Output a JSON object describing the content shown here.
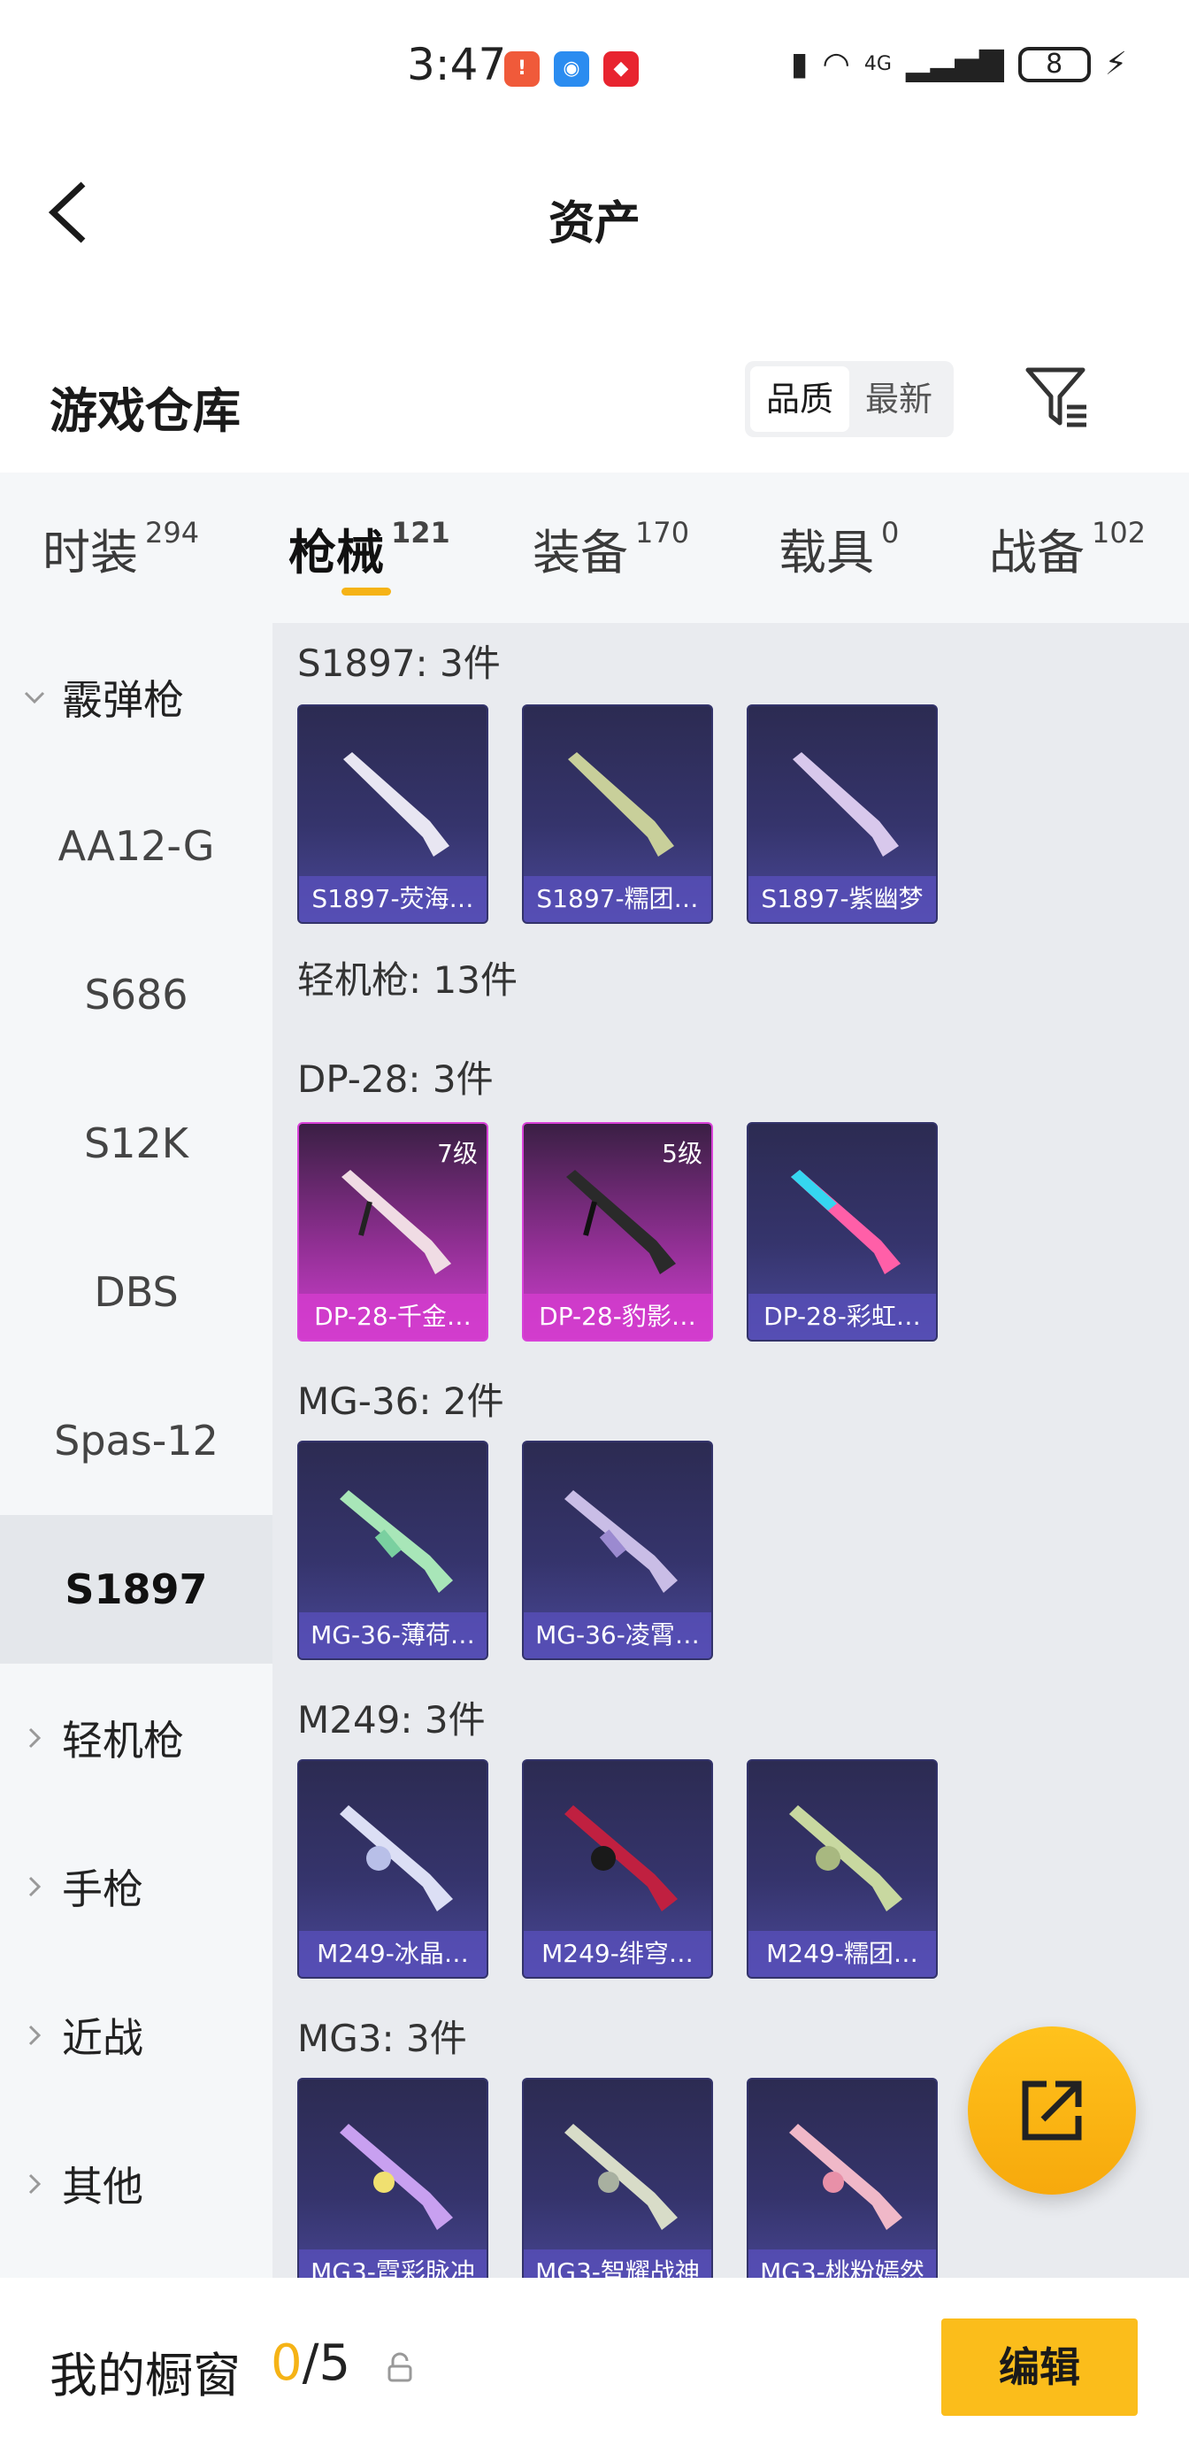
{
  "status_bar": {
    "time": "3:47",
    "battery": "8",
    "network": "4G"
  },
  "header": {
    "title": "资产"
  },
  "warehouse": {
    "title": "游戏仓库",
    "sort_options": [
      "品质",
      "最新"
    ],
    "active_sort": "品质"
  },
  "tabs": [
    {
      "label": "时装",
      "count": "294"
    },
    {
      "label": "枪械",
      "count": "121"
    },
    {
      "label": "装备",
      "count": "170"
    },
    {
      "label": "载具",
      "count": "0"
    },
    {
      "label": "战备",
      "count": "102"
    }
  ],
  "sidebar": {
    "group": "霰弹枪",
    "sub_items": [
      "AA12-G",
      "S686",
      "S12K",
      "DBS",
      "Spas-12",
      "S1897"
    ],
    "selected": "S1897",
    "other_groups": [
      "轻机枪",
      "手枪",
      "近战",
      "其他"
    ]
  },
  "sections": [
    {
      "label": "S1897: 3件",
      "items": [
        {
          "name": "S1897-荧海…",
          "style": "blue"
        },
        {
          "name": "S1897-糯团…",
          "style": "blue"
        },
        {
          "name": "S1897-紫幽梦",
          "style": "blue"
        }
      ]
    },
    {
      "label": "轻机枪: 13件",
      "items": []
    },
    {
      "label": "DP-28: 3件",
      "items": [
        {
          "name": "DP-28-千金…",
          "style": "pink",
          "level": "7级"
        },
        {
          "name": "DP-28-豹影…",
          "style": "pink",
          "level": "5级"
        },
        {
          "name": "DP-28-彩虹…",
          "style": "blue"
        }
      ]
    },
    {
      "label": "MG-36: 2件",
      "items": [
        {
          "name": "MG-36-薄荷…",
          "style": "blue"
        },
        {
          "name": "MG-36-凌霄…",
          "style": "blue"
        }
      ]
    },
    {
      "label": "M249: 3件",
      "items": [
        {
          "name": "M249-冰晶…",
          "style": "blue"
        },
        {
          "name": "M249-绯穹…",
          "style": "blue"
        },
        {
          "name": "M249-糯团…",
          "style": "blue"
        }
      ]
    },
    {
      "label": "MG3: 3件",
      "items": [
        {
          "name": "MG3-霓彩脉冲",
          "style": "blue"
        },
        {
          "name": "MG3-智耀战神",
          "style": "blue"
        },
        {
          "name": "MG3-桃粉嫣然",
          "style": "blue"
        }
      ]
    }
  ],
  "bottom_bar": {
    "label": "我的橱窗",
    "current": "0",
    "total": "/5",
    "edit_label": "编辑"
  },
  "colors": {
    "accent": "#f5b316",
    "selected_bg": "#e4e7eb",
    "card_blue": "#35346c",
    "card_pink": "#d03fd0"
  }
}
